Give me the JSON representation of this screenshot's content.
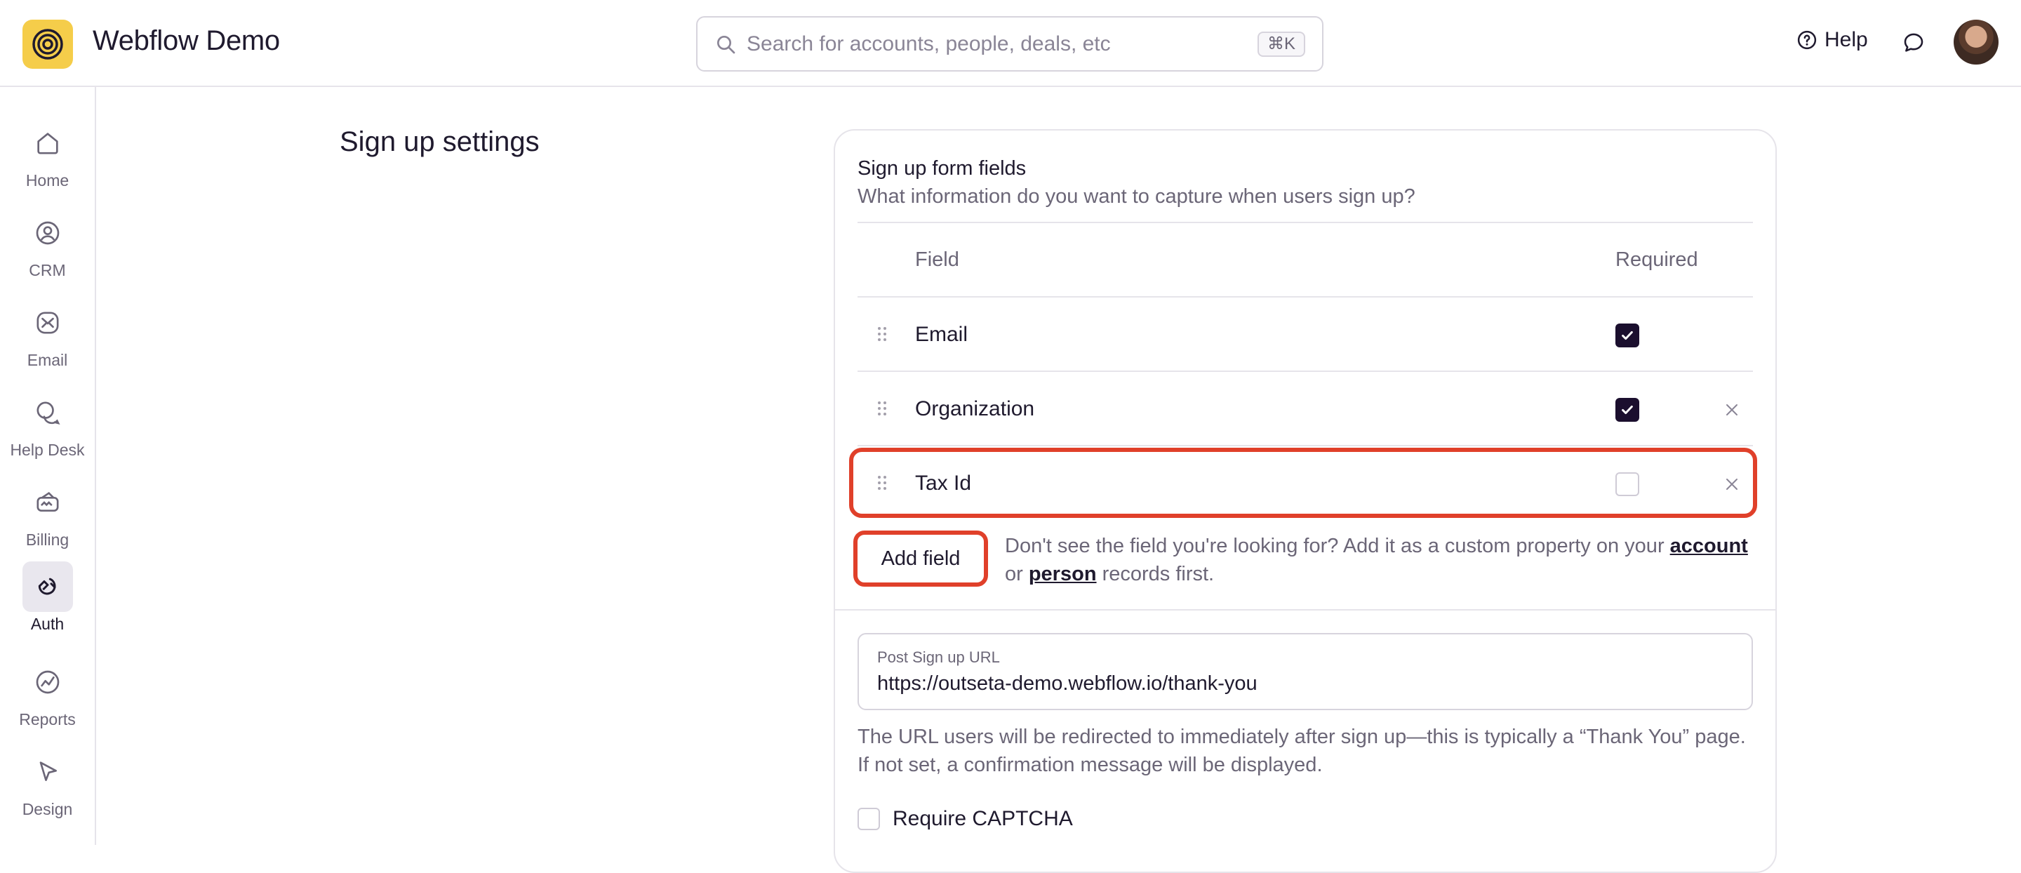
{
  "app": {
    "title": "Webflow Demo"
  },
  "search": {
    "placeholder": "Search for accounts, people, deals, etc",
    "shortcut": "⌘K"
  },
  "header": {
    "help_label": "Help"
  },
  "sidebar": {
    "items": [
      {
        "label": "Home",
        "icon": "home-icon"
      },
      {
        "label": "CRM",
        "icon": "person-circle-icon"
      },
      {
        "label": "Email",
        "icon": "mail-icon"
      },
      {
        "label": "Help Desk",
        "icon": "chat-bubbles-icon"
      },
      {
        "label": "Billing",
        "icon": "billing-icon"
      },
      {
        "label": "Auth",
        "icon": "auth-icon",
        "active": true
      },
      {
        "label": "Reports",
        "icon": "reports-icon"
      },
      {
        "label": "Design",
        "icon": "cursor-icon"
      }
    ]
  },
  "page": {
    "heading": "Sign up settings"
  },
  "form_fields": {
    "title": "Sign up form fields",
    "subtitle": "What information do you want to capture when users sign up?",
    "columns": {
      "field": "Field",
      "required": "Required"
    },
    "rows": [
      {
        "label": "Email",
        "required": true,
        "removable": false
      },
      {
        "label": "Organization",
        "required": true,
        "removable": true
      },
      {
        "label": "Tax Id",
        "required": false,
        "removable": true
      }
    ],
    "add_button": "Add field",
    "hint_before": "Don't see the field you're looking for? Add it as a custom property on your ",
    "hint_link_account": "account",
    "hint_or": " or ",
    "hint_link_person": "person",
    "hint_after": " records first."
  },
  "post_signup": {
    "label": "Post Sign up URL",
    "value": "https://outseta-demo.webflow.io/thank-you",
    "help": "The URL users will be redirected to immediately after sign up—this is typically a “Thank You” page. If not set, a confirmation message will be displayed."
  },
  "captcha": {
    "label": "Require CAPTCHA",
    "checked": false
  },
  "colors": {
    "brand": "#f5cd4a",
    "highlight": "#e0402a",
    "checkbox_on": "#1b0f2e"
  }
}
